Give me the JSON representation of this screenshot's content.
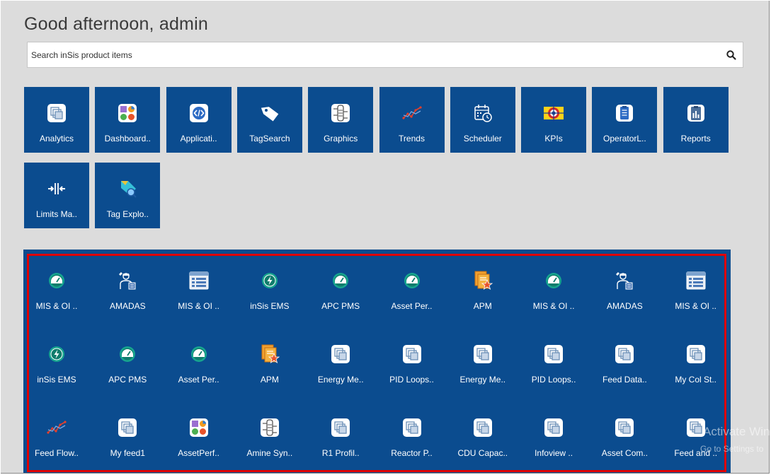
{
  "greeting": "Good afternoon, admin",
  "search": {
    "placeholder": "Search inSis product items"
  },
  "colors": {
    "tile": "#0b4c8f",
    "highlight": "#e00000",
    "background": "#dcdcdc"
  },
  "products": [
    {
      "label": "Analytics",
      "icon": "layers-icon"
    },
    {
      "label": "Dashboard..",
      "icon": "dashboard-icon"
    },
    {
      "label": "Applicati..",
      "icon": "code-icon"
    },
    {
      "label": "TagSearch",
      "icon": "tag-icon"
    },
    {
      "label": "Graphics",
      "icon": "process-diagram-icon"
    },
    {
      "label": "Trends",
      "icon": "trend-icon"
    },
    {
      "label": "Scheduler",
      "icon": "calendar-clock-icon"
    },
    {
      "label": "KPIs",
      "icon": "target-icon"
    },
    {
      "label": "OperatorL..",
      "icon": "checklist-icon"
    },
    {
      "label": "Reports",
      "icon": "clipboard-chart-icon"
    },
    {
      "label": "Limits Ma..",
      "icon": "limits-arrows-icon"
    },
    {
      "label": "Tag Explo..",
      "icon": "tag-search-icon"
    }
  ],
  "items": [
    {
      "label": "MIS & OI ..",
      "icon": "gauge-icon"
    },
    {
      "label": "AMADAS",
      "icon": "engineer-icon"
    },
    {
      "label": "MIS & OI ..",
      "icon": "list-icon"
    },
    {
      "label": "inSis EMS",
      "icon": "power-icon"
    },
    {
      "label": "APC PMS",
      "icon": "gauge-icon"
    },
    {
      "label": "Asset Per..",
      "icon": "gauge-icon"
    },
    {
      "label": "APM",
      "icon": "star-doc-icon"
    },
    {
      "label": "MIS & OI ..",
      "icon": "gauge-icon"
    },
    {
      "label": "AMADAS",
      "icon": "engineer-icon"
    },
    {
      "label": "MIS & OI ..",
      "icon": "list-icon"
    },
    {
      "label": "inSis EMS",
      "icon": "power-icon"
    },
    {
      "label": "APC PMS",
      "icon": "gauge-icon"
    },
    {
      "label": "Asset Per..",
      "icon": "gauge-icon"
    },
    {
      "label": "APM",
      "icon": "star-doc-icon"
    },
    {
      "label": "Energy Me..",
      "icon": "layers-icon"
    },
    {
      "label": "PID Loops..",
      "icon": "layers-icon"
    },
    {
      "label": "Energy Me..",
      "icon": "layers-icon"
    },
    {
      "label": "PID Loops..",
      "icon": "layers-icon"
    },
    {
      "label": "Feed Data..",
      "icon": "layers-icon"
    },
    {
      "label": "My Col St..",
      "icon": "layers-icon"
    },
    {
      "label": "Feed Flow..",
      "icon": "trend-icon"
    },
    {
      "label": "My feed1",
      "icon": "layers-icon"
    },
    {
      "label": "AssetPerf..",
      "icon": "dashboard-icon"
    },
    {
      "label": "Amine Syn..",
      "icon": "process-diagram-icon"
    },
    {
      "label": "R1 Profil..",
      "icon": "layers-icon"
    },
    {
      "label": "Reactor P..",
      "icon": "layers-icon"
    },
    {
      "label": "CDU Capac..",
      "icon": "layers-icon"
    },
    {
      "label": "Infoview ..",
      "icon": "layers-icon"
    },
    {
      "label": "Asset Com..",
      "icon": "layers-icon"
    },
    {
      "label": "Feed and ..",
      "icon": "layers-icon"
    }
  ],
  "watermark": {
    "line1": "Activate Win",
    "line2": "Go to Settings to"
  }
}
